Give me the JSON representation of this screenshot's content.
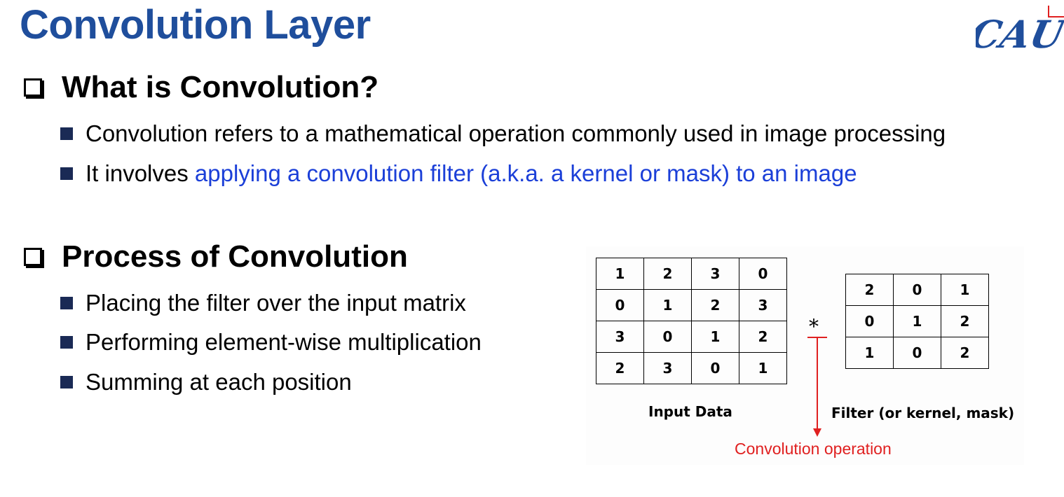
{
  "title": "Convolution Layer",
  "sections": [
    {
      "heading": "What is Convolution?",
      "bullets": [
        {
          "text": "Convolution refers to a mathematical operation commonly used in image processing"
        },
        {
          "prefix": "It involves ",
          "highlight": "applying a convolution filter (a.k.a. a kernel or mask) to an image"
        }
      ]
    },
    {
      "heading": "Process of Convolution",
      "bullets": [
        {
          "text": "Placing the filter over the input matrix"
        },
        {
          "text": "Performing element-wise multiplication"
        },
        {
          "text": "Summing at each position"
        }
      ]
    }
  ],
  "diagram": {
    "input_matrix": [
      [
        "1",
        "2",
        "3",
        "0"
      ],
      [
        "0",
        "1",
        "2",
        "3"
      ],
      [
        "3",
        "0",
        "1",
        "2"
      ],
      [
        "2",
        "3",
        "0",
        "1"
      ]
    ],
    "input_caption": "Input Data",
    "operator": "*",
    "filter_matrix": [
      [
        "2",
        "0",
        "1"
      ],
      [
        "0",
        "1",
        "2"
      ],
      [
        "1",
        "0",
        "2"
      ]
    ],
    "filter_caption": "Filter (or kernel, mask)",
    "operation_label": "Convolution operation",
    "operation_color": "#e02020"
  },
  "colors": {
    "title": "#1f4e9c",
    "highlight": "#1b3fd8",
    "bullet_square": "#1a2a55"
  },
  "logo": {
    "text": "CAU",
    "icon": "cau-logo"
  }
}
